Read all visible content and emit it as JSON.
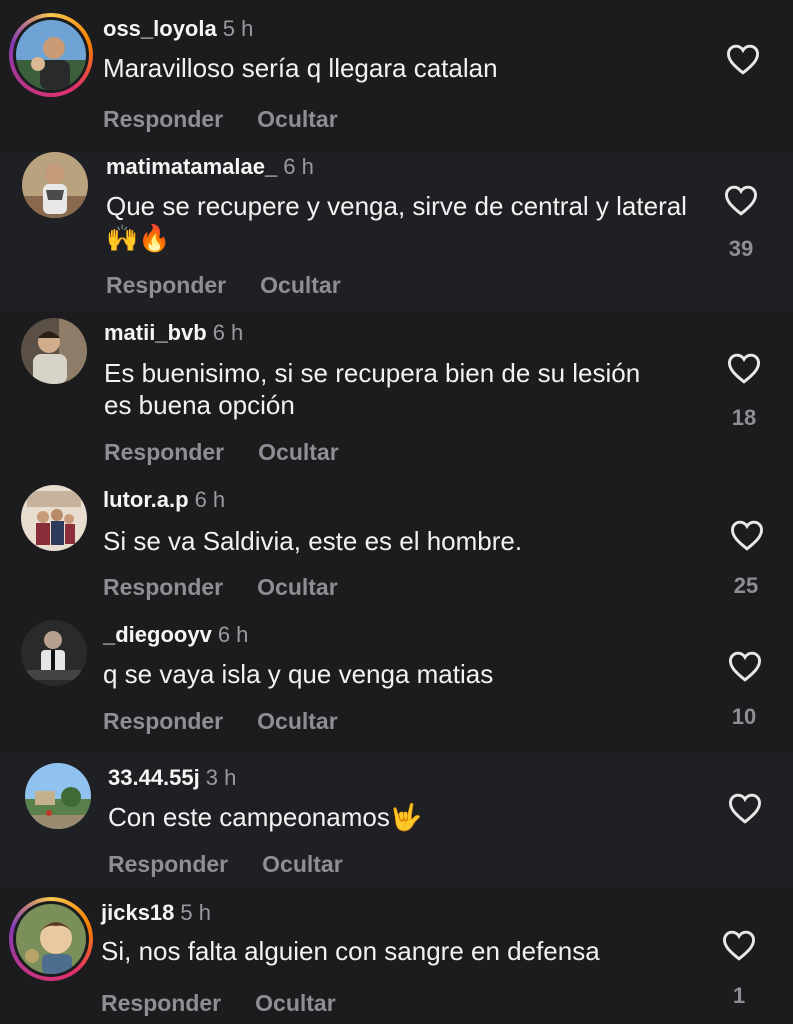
{
  "comments": [
    {
      "username": "oss_loyola",
      "time": "5 h",
      "text": "Maravilloso sería q llegara catalan",
      "likes": "",
      "reply_label": "Responder",
      "hide_label": "Ocultar"
    },
    {
      "username": "matimatamalae_",
      "time": "6 h",
      "text": "Que se recupere y venga, sirve de central y lateral 🙌🔥",
      "likes": "39",
      "reply_label": "Responder",
      "hide_label": "Ocultar"
    },
    {
      "username": "matii_bvb",
      "time": "6 h",
      "text": "Es buenisimo, si se recupera bien de su lesión es buena opción",
      "likes": "18",
      "reply_label": "Responder",
      "hide_label": "Ocultar"
    },
    {
      "username": "lutor.a.p",
      "time": "6 h",
      "text": "Si se va Saldivia, este es el hombre.",
      "likes": "25",
      "reply_label": "Responder",
      "hide_label": "Ocultar"
    },
    {
      "username": "_diegooyv",
      "time": "6 h",
      "text": "q se vaya isla y que venga matias",
      "likes": "10",
      "reply_label": "Responder",
      "hide_label": "Ocultar"
    },
    {
      "username": "33.44.55j",
      "time": "3 h",
      "text": "Con este campeonamos🤟",
      "likes": "",
      "reply_label": "Responder",
      "hide_label": "Ocultar"
    },
    {
      "username": "jicks18",
      "time": "5 h",
      "text": "Si, nos falta alguien con sangre en defensa",
      "likes": "1",
      "reply_label": "Responder",
      "hide_label": "Ocultar"
    }
  ],
  "icons": {
    "like": "heart-outline-icon"
  },
  "colors": {
    "background": "#1c1c1e",
    "secondary_text": "#8e8e93",
    "story_ring": "#e1306c"
  }
}
